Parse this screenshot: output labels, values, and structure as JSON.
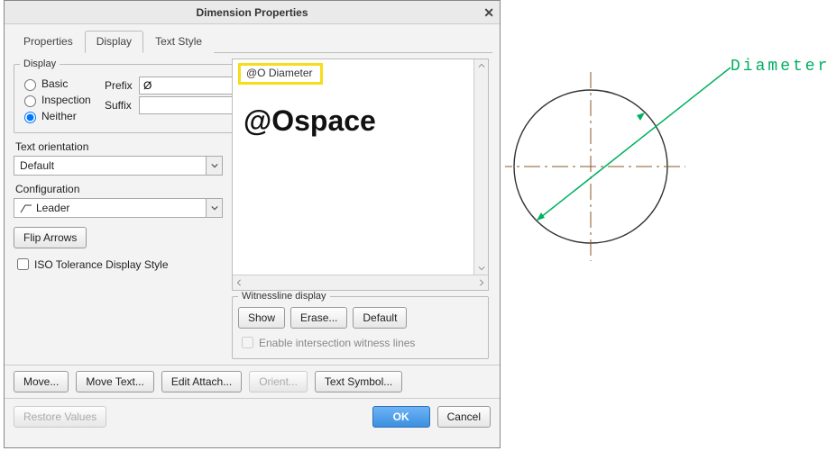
{
  "dialog": {
    "title": "Dimension Properties",
    "tabs": {
      "properties": "Properties",
      "display": "Display",
      "text_style": "Text Style"
    },
    "display": {
      "legend": "Display",
      "basic": "Basic",
      "inspection": "Inspection",
      "neither": "Neither",
      "prefix_label": "Prefix",
      "prefix_value": "Ø",
      "suffix_label": "Suffix",
      "suffix_value": ""
    },
    "text_orientation": {
      "label": "Text orientation",
      "value": "Default"
    },
    "configuration": {
      "label": "Configuration",
      "value": "Leader"
    },
    "flip_arrows": "Flip Arrows",
    "iso_tol": "ISO Tolerance Display Style",
    "preview": {
      "highlight": "@O Diameter",
      "big": "@Ospace"
    },
    "witness": {
      "legend": "Witnessline display",
      "show": "Show",
      "erase": "Erase...",
      "default": "Default",
      "enable": "Enable intersection witness lines"
    },
    "buttons": {
      "move": "Move...",
      "move_text": "Move Text...",
      "edit_attach": "Edit Attach...",
      "orient": "Orient...",
      "text_symbol": "Text Symbol...",
      "restore": "Restore Values",
      "ok": "OK",
      "cancel": "Cancel"
    }
  },
  "drawing": {
    "label": "Diameter"
  }
}
